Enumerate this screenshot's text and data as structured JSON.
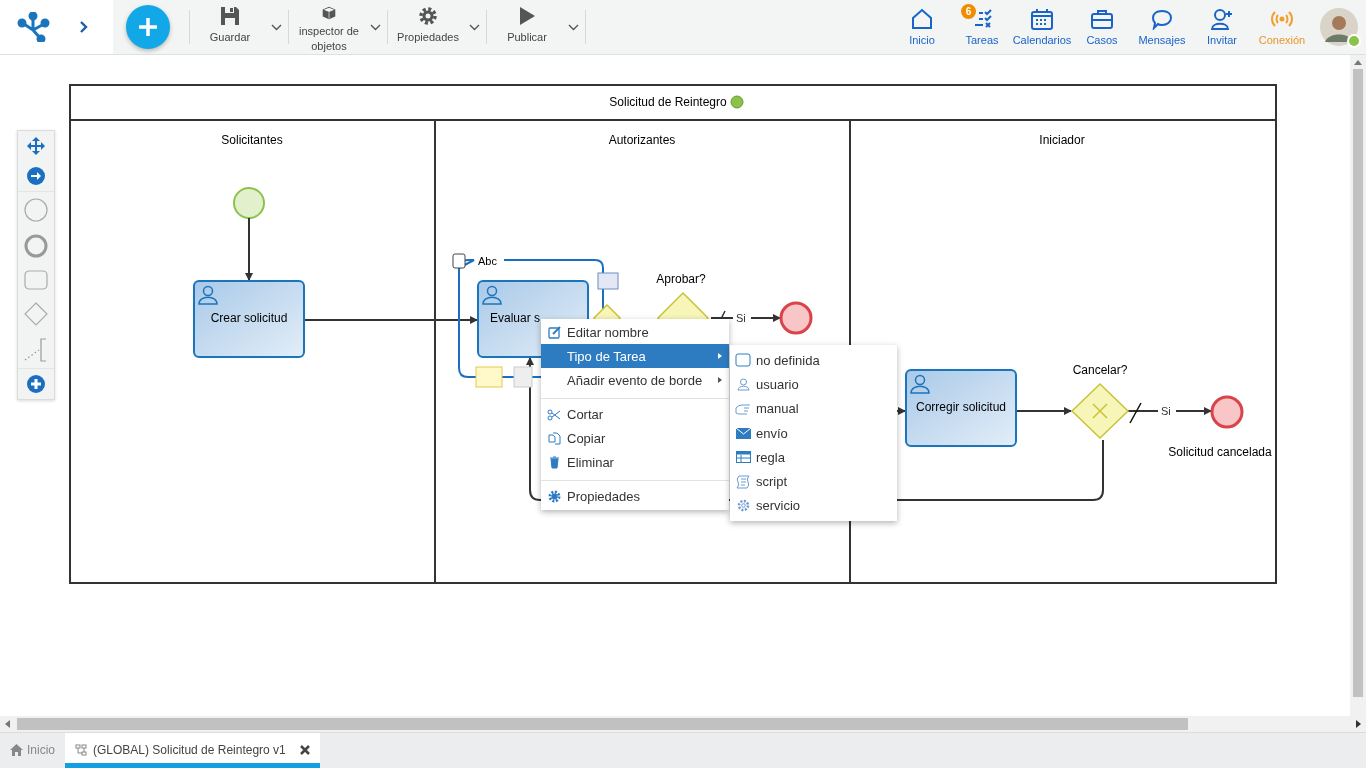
{
  "toolbar": {
    "buttons": [
      {
        "label": "Guardar",
        "kind": "save"
      },
      {
        "label": "inspector de objetos",
        "kind": "inspector"
      },
      {
        "label": "Propiedades",
        "kind": "properties"
      },
      {
        "label": "Publicar",
        "kind": "publish"
      }
    ]
  },
  "nav": [
    {
      "label": "Inicio",
      "kind": "home"
    },
    {
      "label": "Tareas",
      "kind": "tasks",
      "badge": "6"
    },
    {
      "label": "Calendarios",
      "kind": "calendar"
    },
    {
      "label": "Casos",
      "kind": "cases"
    },
    {
      "label": "Mensajes",
      "kind": "messages"
    },
    {
      "label": "Invitar",
      "kind": "invite"
    },
    {
      "label": "Conexión",
      "kind": "connection"
    }
  ],
  "user": {
    "online": true
  },
  "diagram": {
    "pool_title": "Solicitud de Reintegro",
    "lanes": [
      "Solicitantes",
      "Autorizantes",
      "Iniciador"
    ],
    "tasks": [
      "Crear solicitud",
      "Evaluar s",
      "Corregir solicitud"
    ],
    "gateways": [
      "Aprobar?",
      "Cancelar?"
    ],
    "flow_labels": [
      "Si",
      "Si"
    ],
    "end_label": "Solicitud cancelada",
    "annotation": "Abc"
  },
  "context_menu": [
    {
      "label": "Editar nombre",
      "kind": "edit",
      "selected": false,
      "has_submenu": false,
      "divider_before": false
    },
    {
      "label": "Tipo de Tarea",
      "kind": "none",
      "selected": true,
      "has_submenu": true,
      "divider_before": false
    },
    {
      "label": "Añadir evento de borde",
      "kind": "none",
      "selected": false,
      "has_submenu": true,
      "divider_before": false
    },
    {
      "label": "Cortar",
      "kind": "cut",
      "selected": false,
      "has_submenu": false,
      "divider_before": true
    },
    {
      "label": "Copiar",
      "kind": "copy",
      "selected": false,
      "has_submenu": false,
      "divider_before": false
    },
    {
      "label": "Eliminar",
      "kind": "delete",
      "selected": false,
      "has_submenu": false,
      "divider_before": false
    },
    {
      "label": "Propiedades",
      "kind": "properties",
      "selected": false,
      "has_submenu": false,
      "divider_before": true
    }
  ],
  "submenu": [
    {
      "label": "no definida",
      "kind": "undefined"
    },
    {
      "label": "usuario",
      "kind": "user"
    },
    {
      "label": "manual",
      "kind": "manual"
    },
    {
      "label": "envío",
      "kind": "send"
    },
    {
      "label": "regla",
      "kind": "rule"
    },
    {
      "label": "script",
      "kind": "script"
    },
    {
      "label": "servicio",
      "kind": "service"
    }
  ],
  "tabs": [
    {
      "label": "Inicio",
      "kind": "home",
      "selected": false,
      "closable": false
    },
    {
      "label": "(GLOBAL) Solicitud de Reintegro v1",
      "kind": "process",
      "selected": true,
      "closable": true
    }
  ]
}
